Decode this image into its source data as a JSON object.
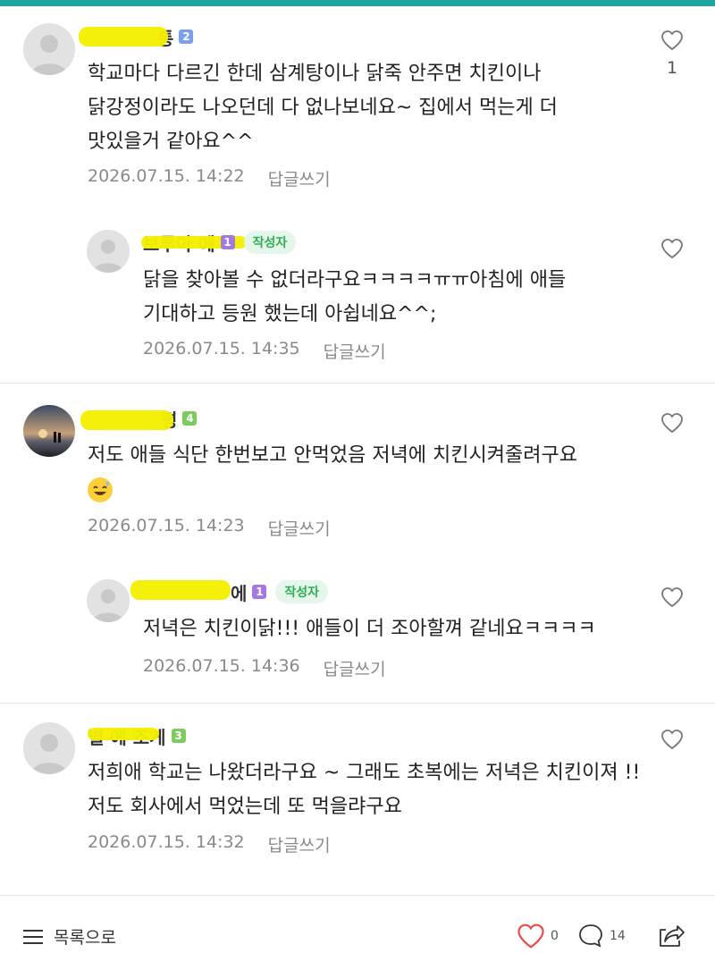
{
  "comments": [
    {
      "name": "통",
      "level": "2",
      "text": "학교마다 다르긴 한데 삼계탕이나 닭죽 안주면 치킨이나 닭강정이라도 나오던데 다 없나보네요~ 집에서 먹는게 더 맛있을거 같아요^^",
      "date": "2026.07.15. 14:22",
      "reply_label": "답글쓰기",
      "likes": "1"
    },
    {
      "name": "보루아 에",
      "level": "1",
      "badge": "작성자",
      "text": "닭을 찾아볼 수 없더라구요ㅋㅋㅋㅋㅠㅠ아침에 애들 기대하고 등원 했는데 아쉽네요^^;",
      "date": "2026.07.15. 14:35",
      "reply_label": "답글쓰기"
    },
    {
      "name": "평",
      "level": "4",
      "text": "저도 애들 식단 한번보고 안먹었음 저녁에 치킨시켜줄려구요",
      "date": "2026.07.15. 14:23",
      "reply_label": "답글쓰기"
    },
    {
      "name": "에",
      "level": "1",
      "badge": "작성자",
      "text": "저녁은 치킨이닭!!! 애들이 더 조아할껴 같네요ㅋㅋㅋㅋ",
      "date": "2026.07.15. 14:36",
      "reply_label": "답글쓰기"
    },
    {
      "name": "별 에 조게",
      "level": "3",
      "text": "저희애 학교는 나왔더라구요 ~ 그래도 초복에는 저녁은 치킨이져 !! 저도 회사에서 먹었는데 또 먹을랴구요",
      "date": "2026.07.15. 14:32",
      "reply_label": "답글쓰기"
    }
  ],
  "bottom_bar": {
    "list_label": "목록으로",
    "like_count": "0",
    "comment_count": "14"
  },
  "colors": {
    "accent": "#1aa79d",
    "like_red": "#e94b4b",
    "author_badge": "#2fae56"
  },
  "icons": [
    "menu-icon",
    "heart-icon",
    "comment-icon",
    "share-icon",
    "avatar-placeholder-icon"
  ]
}
